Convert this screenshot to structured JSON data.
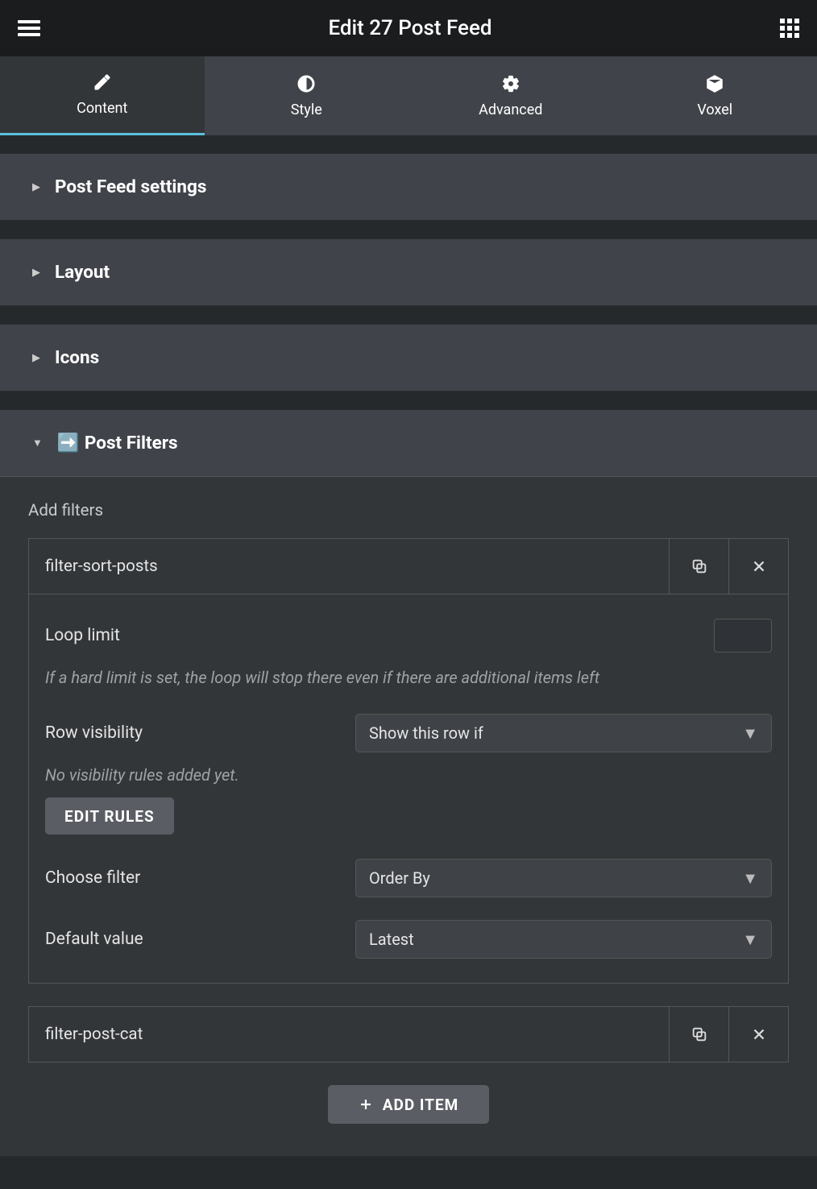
{
  "header": {
    "title": "Edit 27 Post Feed"
  },
  "tabs": {
    "content": "Content",
    "style": "Style",
    "advanced": "Advanced",
    "voxel": "Voxel"
  },
  "sections": {
    "post_feed_settings": "Post Feed settings",
    "layout": "Layout",
    "icons": "Icons",
    "post_filters": "Post Filters",
    "post_filters_icon": "➡️"
  },
  "panel": {
    "subtitle": "Add filters",
    "items": [
      {
        "name": "filter-sort-posts"
      },
      {
        "name": "filter-post-cat"
      }
    ],
    "expand": {
      "loop_limit_label": "Loop limit",
      "loop_limit_help": "If a hard limit is set, the loop will stop there even if there are additional items left",
      "row_visibility_label": "Row visibility",
      "row_visibility_value": "Show this row if",
      "visibility_note": "No visibility rules added yet.",
      "edit_rules_btn": "EDIT RULES",
      "choose_filter_label": "Choose filter",
      "choose_filter_value": "Order By",
      "default_value_label": "Default value",
      "default_value_value": "Latest"
    },
    "add_item_btn": "ADD ITEM"
  }
}
